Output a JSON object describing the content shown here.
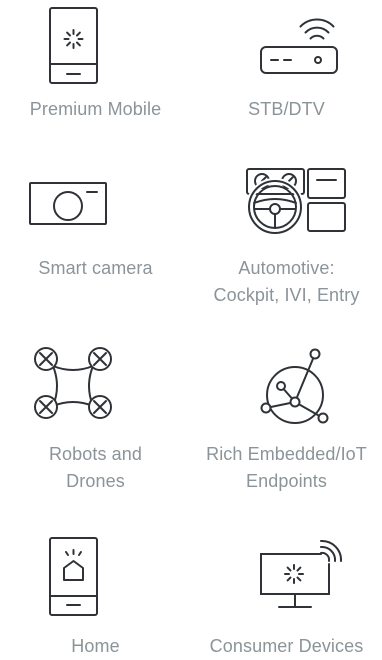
{
  "items": [
    {
      "label": "Premium Mobile",
      "icon": "smartphone-icon"
    },
    {
      "label": "STB/DTV",
      "icon": "set-top-box-icon"
    },
    {
      "label": "Smart camera",
      "icon": "camera-icon"
    },
    {
      "label_line1": "Automotive:",
      "label_line2": "Cockpit, IVI, Entry",
      "icon": "car-dashboard-icon"
    },
    {
      "label_line1": "Robots and",
      "label_line2": "Drones",
      "icon": "drone-icon"
    },
    {
      "label_line1": "Rich Embedded/IoT",
      "label_line2": "Endpoints",
      "icon": "network-globe-icon"
    },
    {
      "label": "Home",
      "icon": "smart-home-phone-icon"
    },
    {
      "label": "Consumer Devices",
      "icon": "smart-display-icon"
    }
  ],
  "colors": {
    "icon_stroke": "#2f3338",
    "label_text": "#8b9499"
  }
}
